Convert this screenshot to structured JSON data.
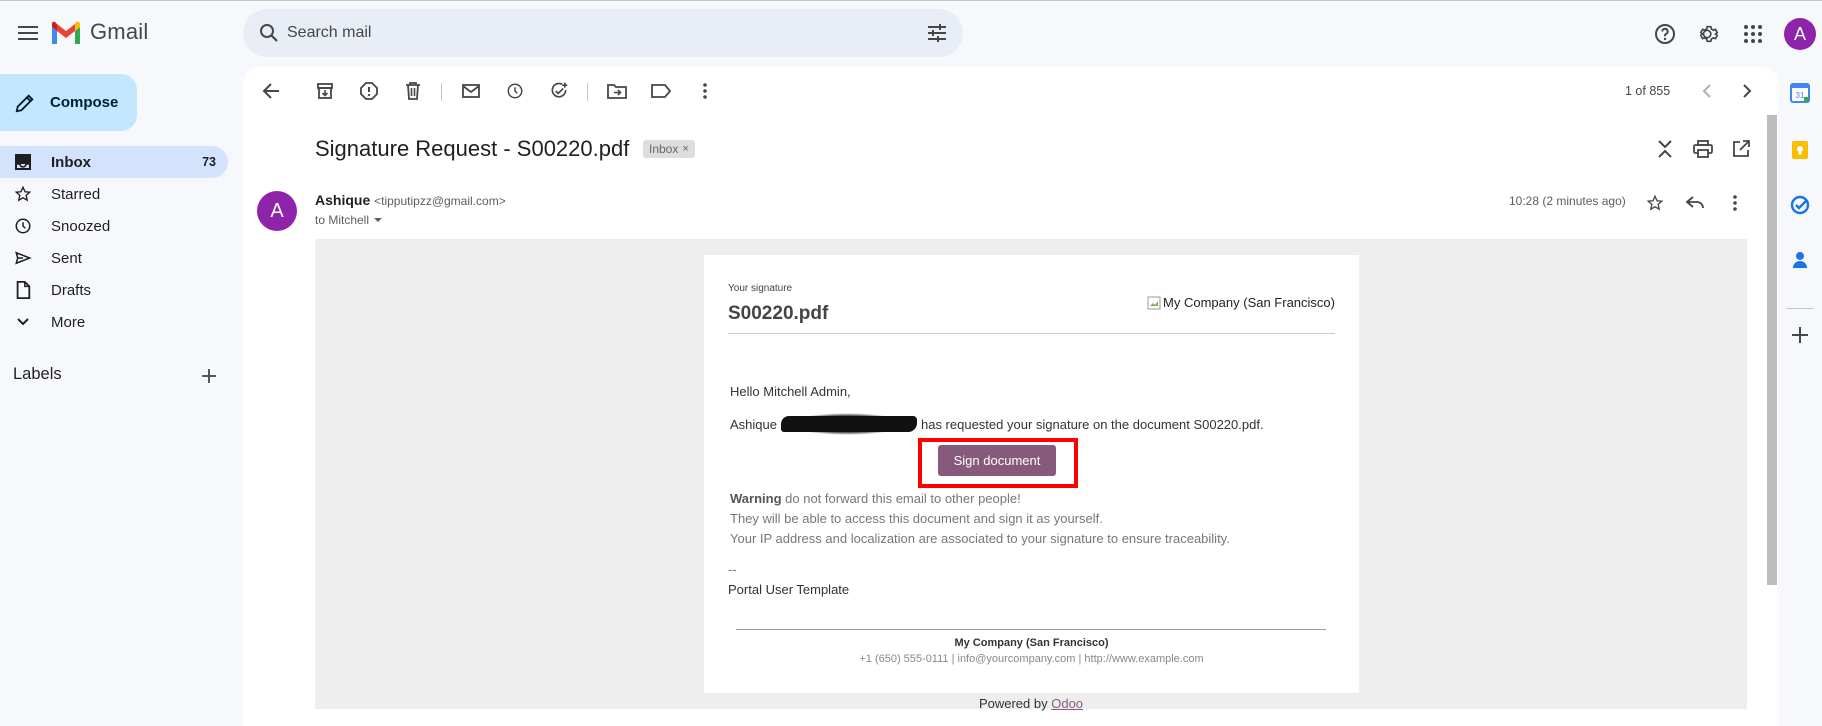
{
  "app": {
    "name": "Gmail",
    "avatar_letter": "A",
    "brand_color": "#8e24aa"
  },
  "search": {
    "placeholder": "Search mail"
  },
  "compose": {
    "label": "Compose"
  },
  "nav": [
    {
      "label": "Inbox",
      "count": "73",
      "icon": "inbox-icon"
    },
    {
      "label": "Starred",
      "count": "",
      "icon": "star-icon"
    },
    {
      "label": "Snoozed",
      "count": "",
      "icon": "clock-icon"
    },
    {
      "label": "Sent",
      "count": "",
      "icon": "send-icon"
    },
    {
      "label": "Drafts",
      "count": "",
      "icon": "draft-icon"
    },
    {
      "label": "More",
      "count": "",
      "icon": "chevron-down-icon"
    }
  ],
  "labels": {
    "title": "Labels"
  },
  "pager": {
    "text": "1 of 855"
  },
  "message": {
    "subject": "Signature Request - S00220.pdf",
    "chip": "Inbox",
    "sender_name": "Ashique",
    "sender_email": "<tipputipzz@gmail.com>",
    "sender_initial": "A",
    "to": "to Mitchell",
    "time": "10:28 (2 minutes ago)"
  },
  "email": {
    "your_signature": "Your signature",
    "doc_name": "S00220.pdf",
    "company_image_alt": "My Company (San Francisco)",
    "greeting": "Hello Mitchell Admin,",
    "request_prefix": "Ashique",
    "request_suffix": "has requested your signature on the document S00220.pdf.",
    "button": "Sign document",
    "warning_bold": "Warning",
    "warning_line1": "do not forward this email to other people!",
    "warning_line2": "They will be able to access this document and sign it as yourself.",
    "warning_line3": "Your IP address and localization are associated to your signature to ensure traceability.",
    "dashes": "--",
    "signature_name": "Portal User Template",
    "footer_company": "My Company (San Francisco)",
    "footer_contact": "+1 (650) 555-0111 | info@yourcompany.com | http://www.example.com",
    "powered_prefix": "Powered by",
    "powered_link": "Odoo",
    "button_color": "#875a7b"
  }
}
